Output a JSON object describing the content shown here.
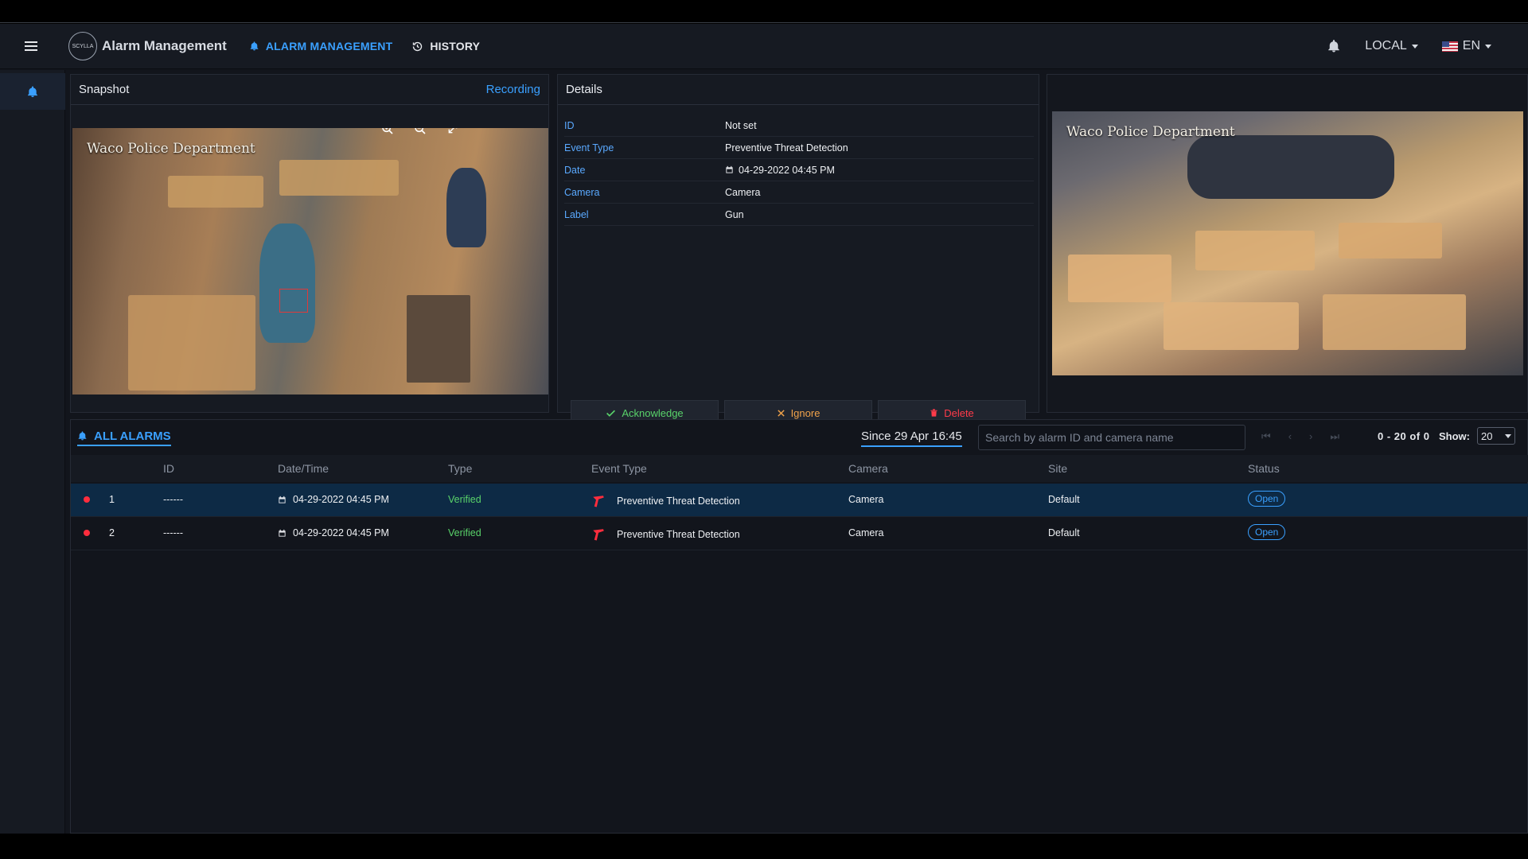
{
  "app": {
    "brand": "Alarm Management",
    "logo_text": "SCYLLA"
  },
  "nav": {
    "alarm_management": "ALARM MANAGEMENT",
    "history": "HISTORY",
    "local": "LOCAL",
    "language": "EN"
  },
  "snapshot": {
    "title": "Snapshot",
    "recording_link": "Recording",
    "caption": "Waco Police Department"
  },
  "details": {
    "title": "Details",
    "rows": [
      {
        "key": "ID",
        "value": "Not set"
      },
      {
        "key": "Event Type",
        "value": "Preventive Threat Detection"
      },
      {
        "key": "Date",
        "value": "04-29-2022 04:45 PM"
      },
      {
        "key": "Camera",
        "value": "Camera"
      },
      {
        "key": "Label",
        "value": "Gun"
      }
    ],
    "buttons": {
      "acknowledge": "Acknowledge",
      "ignore": "Ignore",
      "delete": "Delete"
    }
  },
  "live": {
    "caption": "Waco Police Department"
  },
  "alarms": {
    "title": "ALL ALARMS",
    "since": "Since 29 Apr 16:45",
    "search_placeholder": "Search by alarm ID and camera name",
    "range": "0 - 20 of 0",
    "show_label": "Show:",
    "show_value": "20",
    "columns": [
      "ID",
      "Date/Time",
      "Type",
      "Event Type",
      "Camera",
      "Site",
      "Status"
    ],
    "rows": [
      {
        "index": "1",
        "id": "------",
        "datetime": "04-29-2022 04:45 PM",
        "type": "Verified",
        "event_type": "Preventive Threat Detection",
        "camera": "Camera",
        "site": "Default",
        "status": "Open"
      },
      {
        "index": "2",
        "id": "------",
        "datetime": "04-29-2022 04:45 PM",
        "type": "Verified",
        "event_type": "Preventive Threat Detection",
        "camera": "Camera",
        "site": "Default",
        "status": "Open"
      }
    ]
  },
  "colors": {
    "accent": "#3aa0ff",
    "danger": "#ff2d3d",
    "success": "#59d36a",
    "background": "#12151c"
  }
}
